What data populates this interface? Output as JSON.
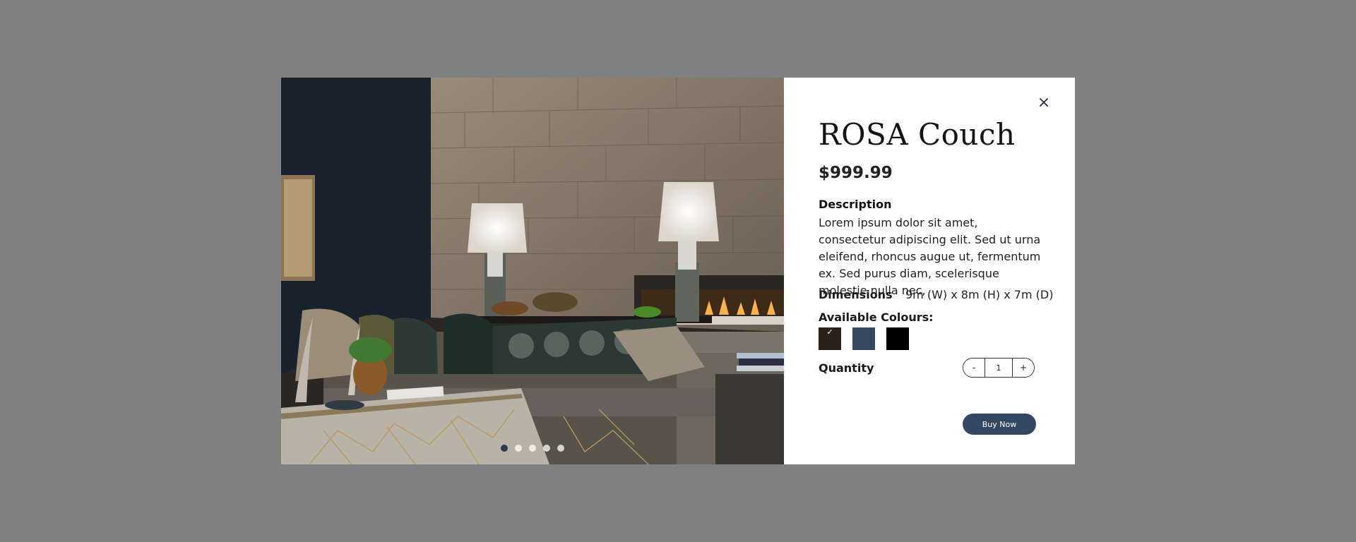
{
  "product": {
    "title": "ROSA Couch",
    "price": "$999.99",
    "description_label": "Description",
    "description": "Lorem ipsum dolor sit amet, consectetur adipiscing elit. Sed ut urna eleifend, rhoncus augue ut, fermentum ex. Sed purus diam, scelerisque molestie nulla nec,",
    "dimensions_label": "Dimensions",
    "dimensions": "9m (W) x 8m (H) x 7m (D)",
    "colours_label": "Available Colours:",
    "colours": [
      {
        "name": "brown",
        "hex": "#2b211b",
        "selected": true
      },
      {
        "name": "navy",
        "hex": "#364760",
        "selected": false
      },
      {
        "name": "black",
        "hex": "#000000",
        "selected": false
      }
    ],
    "quantity_label": "Quantity",
    "quantity": "1",
    "decrement": "-",
    "increment": "+",
    "buy_label": "Buy Now",
    "close_icon": "×",
    "check_icon": "✓"
  },
  "carousel": {
    "slides": 5,
    "active": 0,
    "image": "living-room-couch-photo"
  },
  "colors": {
    "overlay": "#808080",
    "accent": "#344760"
  }
}
